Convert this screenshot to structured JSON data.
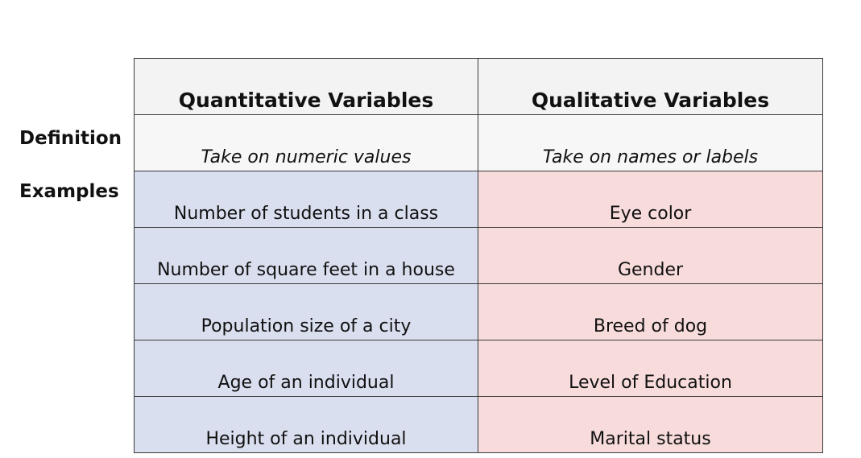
{
  "row_labels": {
    "definition": "Definition",
    "examples": "Examples"
  },
  "headers": {
    "quantitative": "Quantitative Variables",
    "qualitative": "Qualitative Variables"
  },
  "definitions": {
    "quantitative": "Take on numeric values",
    "qualitative": "Take on names or labels"
  },
  "examples": [
    {
      "quantitative": "Number of students in a class",
      "qualitative": "Eye color"
    },
    {
      "quantitative": "Number of square feet in a house",
      "qualitative": "Gender"
    },
    {
      "quantitative": "Population size of a city",
      "qualitative": "Breed of dog"
    },
    {
      "quantitative": "Age of an individual",
      "qualitative": "Level of Education"
    },
    {
      "quantitative": "Height of an individual",
      "qualitative": "Marital status"
    }
  ],
  "colors": {
    "header_bg": "#f3f3f3",
    "definition_bg": "#f7f7f7",
    "quantitative_bg": "#dadfef",
    "qualitative_bg": "#f8dbdb",
    "border": "#3a3a3a"
  }
}
